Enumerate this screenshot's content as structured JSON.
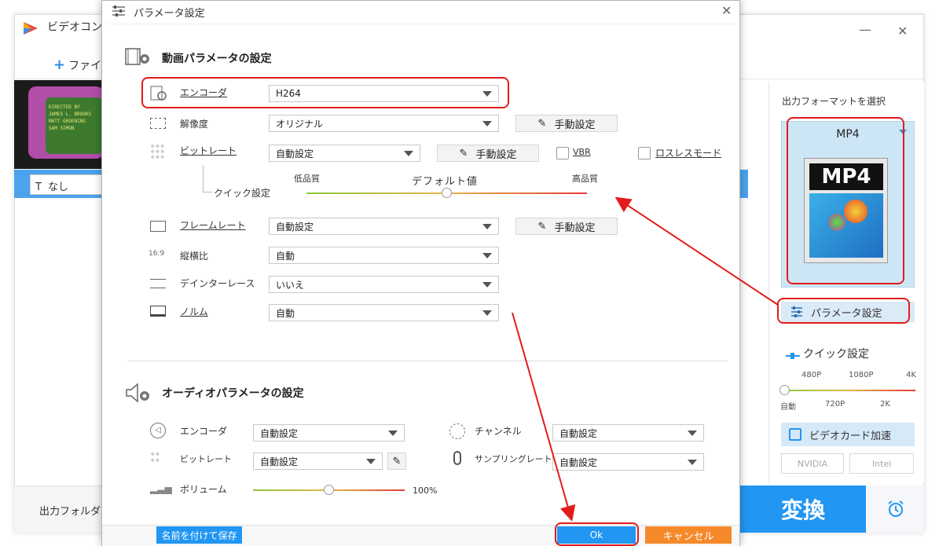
{
  "main_window": {
    "title": "ビデオコン",
    "add_file": "ファイ",
    "subtitle_value": "なし",
    "output_folder_label": "出力フォルダ：",
    "convert_label": "変換",
    "thumb_lines": [
      "DIRECTED BY",
      "JAMES L. BROOKS",
      "MATT GROENING",
      "SAM SIMON"
    ]
  },
  "right_panel": {
    "format_label": "出力フォーマットを選択",
    "format_name": "MP4",
    "format_thumb_text": "MP4",
    "param_button": "パラメータ設定",
    "quick_label": "クイック設定",
    "quick_top_ticks": [
      "480P",
      "1080P",
      "4K"
    ],
    "quick_bottom_ticks": [
      "自動",
      "720P",
      "2K"
    ],
    "gpu_label": "ビデオカード加速",
    "vendors": [
      "NVIDIA",
      "Intel"
    ]
  },
  "dialog": {
    "title": "パラメータ設定",
    "video_section": "動画パラメータの設定",
    "audio_section": "オーディオパラメータの設定",
    "video_rows": {
      "encoder": {
        "label": "エンコーダ",
        "value": "H264"
      },
      "resolution": {
        "label": "解像度",
        "value": "オリジナル",
        "manual": "手動設定"
      },
      "bitrate": {
        "label": "ビットレート",
        "value": "自動設定",
        "manual": "手動設定",
        "vbr": "VBR",
        "lossless": "ロスレスモード"
      },
      "quick": {
        "label": "クイック設定",
        "low": "低品質",
        "default": "デフォルト値",
        "high": "高品質"
      },
      "framerate": {
        "label": "フレームレート",
        "value": "自動設定",
        "manual": "手動設定"
      },
      "aspect": {
        "label": "縦横比",
        "value": "自動",
        "icon_text": "16:9"
      },
      "deinterlace": {
        "label": "デインターレース",
        "value": "いいえ"
      },
      "norm": {
        "label": "ノルム",
        "value": "自動"
      }
    },
    "audio_rows": {
      "encoder": {
        "label": "エンコーダ",
        "value": "自動設定"
      },
      "bitrate": {
        "label": "ビットレート",
        "value": "自動設定"
      },
      "volume": {
        "label": "ボリューム",
        "value": "100%"
      },
      "channel": {
        "label": "チャンネル",
        "value": "自動設定"
      },
      "samplerate": {
        "label": "サンプリングレート",
        "value": "自動設定"
      }
    },
    "save_as": "名前を付けて保存",
    "ok": "Ok",
    "cancel": "キャンセル"
  },
  "colors": {
    "accent_blue": "#2196f3",
    "cancel_orange": "#f5892a",
    "annotation_red": "#e31b1b"
  }
}
